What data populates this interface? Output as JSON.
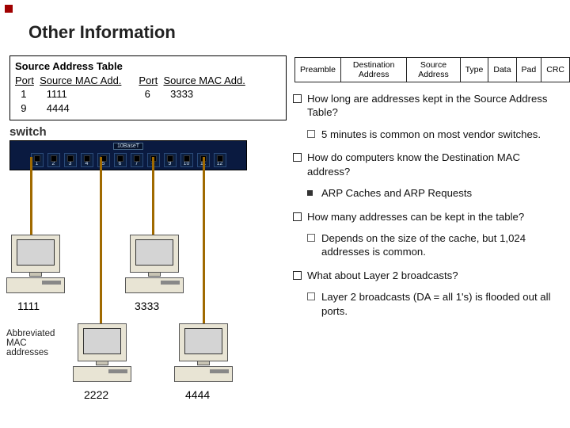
{
  "slide": {
    "title": "Other Information"
  },
  "sat": {
    "title": "Source Address Table",
    "head_port": "Port",
    "head_mac": "Source MAC Add.",
    "left": {
      "r1_port": "1",
      "r1_mac": "1111",
      "r2_port": "9",
      "r2_mac": "4444"
    },
    "right": {
      "r1_port": "6",
      "r1_mac": "3333"
    }
  },
  "frame_fields": [
    "Preamble",
    "Destination Address",
    "Source Address",
    "Type",
    "Data",
    "Pad",
    "CRC"
  ],
  "switch": {
    "label": "switch",
    "band": "10BaseT",
    "ports": [
      "1",
      "2",
      "3",
      "4",
      "5",
      "6",
      "7",
      "8",
      "9",
      "10",
      "11",
      "12"
    ]
  },
  "pcs": {
    "pc1_label": "1111",
    "pc2_label": "3333",
    "pc3_label": "2222",
    "pc4_label": "4444"
  },
  "abbrev_note": "Abbreviated MAC addresses",
  "qa": {
    "q1": "How long are addresses kept in the Source Address Table?",
    "a1": "5 minutes is common on most vendor switches.",
    "q2": "How do computers know the Destination MAC address?",
    "a2": "ARP Caches and ARP Requests",
    "q3": "How many addresses can be kept in the table?",
    "a3": "Depends on the size of the cache, but 1,024 addresses is common.",
    "q4": "What about Layer 2 broadcasts?",
    "a4": "Layer 2 broadcasts (DA = all 1's) is flooded out all ports."
  }
}
